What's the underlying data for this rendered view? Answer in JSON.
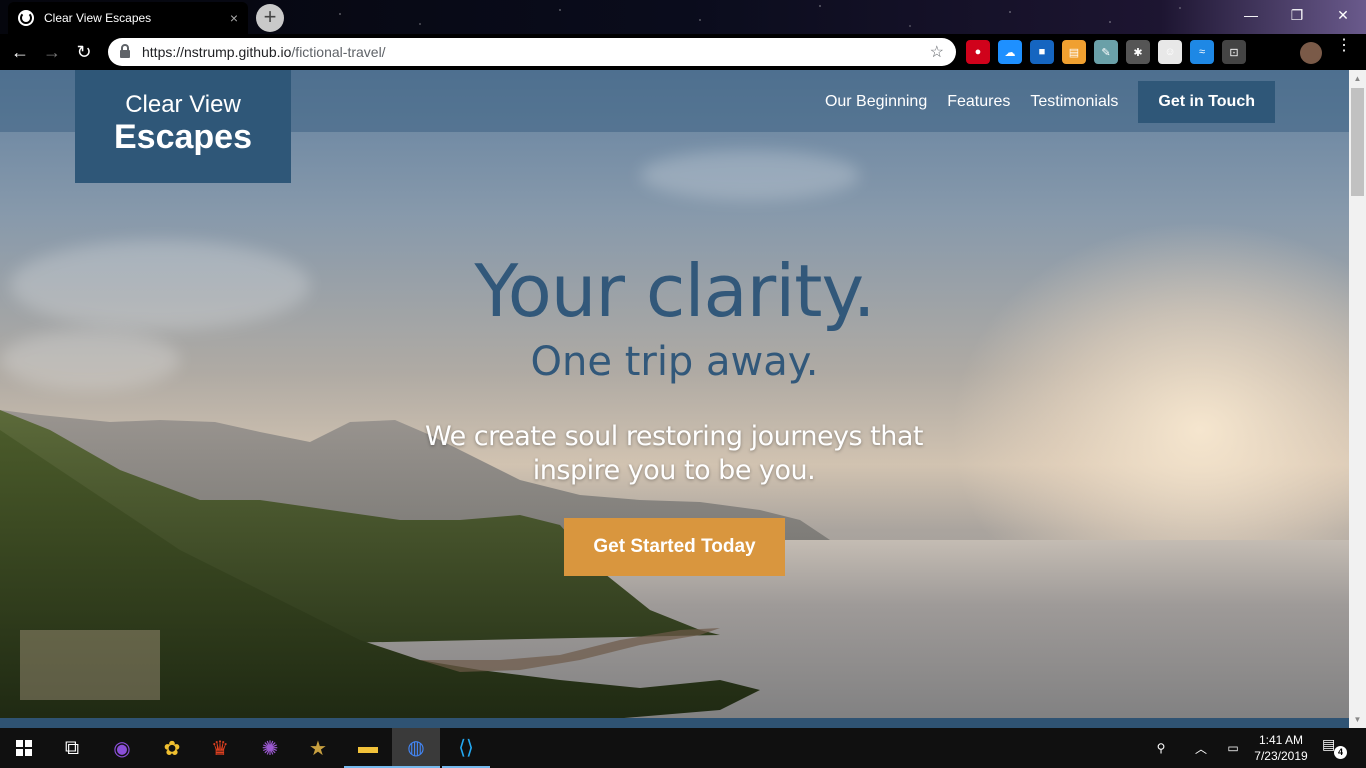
{
  "browser": {
    "tab_title": "Clear View Escapes",
    "tab_close": "×",
    "new_tab": "+",
    "window_controls": {
      "minimize": "—",
      "maximize": "❐",
      "close": "✕"
    },
    "nav": {
      "back": "←",
      "forward": "→",
      "reload": "↻"
    },
    "url_host": "https://nstrump.github.io",
    "url_path": "/fictional-travel/",
    "bookmark_star": "☆",
    "extensions": [
      {
        "name": "adblock-icon",
        "color": "#d0021b",
        "glyph": "●"
      },
      {
        "name": "cloud-icon",
        "color": "#1e90ff",
        "glyph": "☁"
      },
      {
        "name": "square-extension-icon",
        "color": "#1565c0",
        "glyph": "■"
      },
      {
        "name": "note-extension-icon",
        "color": "#f0a030",
        "glyph": "▤"
      },
      {
        "name": "dropper-extension-icon",
        "color": "#6aa0a8",
        "glyph": "✎"
      },
      {
        "name": "lightbulb-icon",
        "color": "#555555",
        "glyph": "✱"
      },
      {
        "name": "avatar-extension-icon",
        "color": "#e8e8e8",
        "glyph": "☺"
      },
      {
        "name": "wireless-icon",
        "color": "#1e88e5",
        "glyph": "≈"
      },
      {
        "name": "screenshot-icon",
        "color": "#444444",
        "glyph": "⊡"
      }
    ],
    "menu": "⋮"
  },
  "site": {
    "logo_line1": "Clear View",
    "logo_line2": "Escapes",
    "nav": [
      "Our Beginning",
      "Features",
      "Testimonials"
    ],
    "cta": "Get in Touch",
    "hero_title": "Your clarity.",
    "hero_subtitle": "One trip away.",
    "hero_text": "We create soul restoring journeys that inspire you to be you.",
    "hero_button": "Get Started Today",
    "colors": {
      "brand": "#2f5778",
      "accent": "#d9963e",
      "heading": "#32587a"
    }
  },
  "taskbar": {
    "apps": [
      {
        "name": "start-button",
        "icon": "windows-icon"
      },
      {
        "name": "task-view-button",
        "icon": "task-view-icon",
        "glyph": "⧉"
      },
      {
        "name": "app-lens",
        "icon": "camera-lens-icon",
        "color": "#8a4fd8",
        "glyph": "◉"
      },
      {
        "name": "app-photos",
        "icon": "flower-icon",
        "color": "#f0c030",
        "glyph": "✿"
      },
      {
        "name": "app-crown",
        "icon": "crown-icon",
        "color": "#e04020",
        "glyph": "♛"
      },
      {
        "name": "app-purple",
        "icon": "spiral-icon",
        "color": "#9b59d0",
        "glyph": "✺"
      },
      {
        "name": "app-star",
        "icon": "star-icon",
        "color": "#c8a040",
        "glyph": "★"
      },
      {
        "name": "app-explorer",
        "icon": "folder-icon",
        "color": "#f2c23a",
        "glyph": "▬"
      },
      {
        "name": "app-chrome",
        "icon": "chrome-icon",
        "color": "#4285f4",
        "glyph": "◍"
      },
      {
        "name": "app-vscode",
        "icon": "vscode-icon",
        "color": "#23a9f2",
        "glyph": "⟨⟩"
      }
    ],
    "tray_people": "⚲",
    "tray_chevron": "︿",
    "tray_battery": "▭",
    "time": "1:41 AM",
    "date": "7/23/2019",
    "notifications": "4",
    "notif_icon": "▤"
  }
}
